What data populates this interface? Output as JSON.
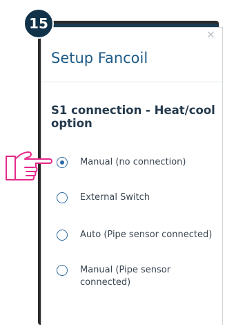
{
  "step_badge": "15",
  "modal": {
    "close_icon": "×",
    "title": "Setup Fancoil",
    "section_title": "S1 connection - Heat/cool option",
    "options": [
      {
        "label": "Manual (no connection)",
        "selected": true
      },
      {
        "label": "External Switch",
        "selected": false
      },
      {
        "label": "Auto (Pipe sensor connected)",
        "selected": false
      },
      {
        "label": "Manual (Pipe sensor connected)",
        "selected": false
      }
    ]
  },
  "colors": {
    "accent": "#1d5a86",
    "radio": "#2c6aa3",
    "badge": "#12324a",
    "hand_outline": "#e6288a"
  },
  "icons": {
    "pointer": "pointing-hand-icon",
    "close": "close-icon"
  }
}
